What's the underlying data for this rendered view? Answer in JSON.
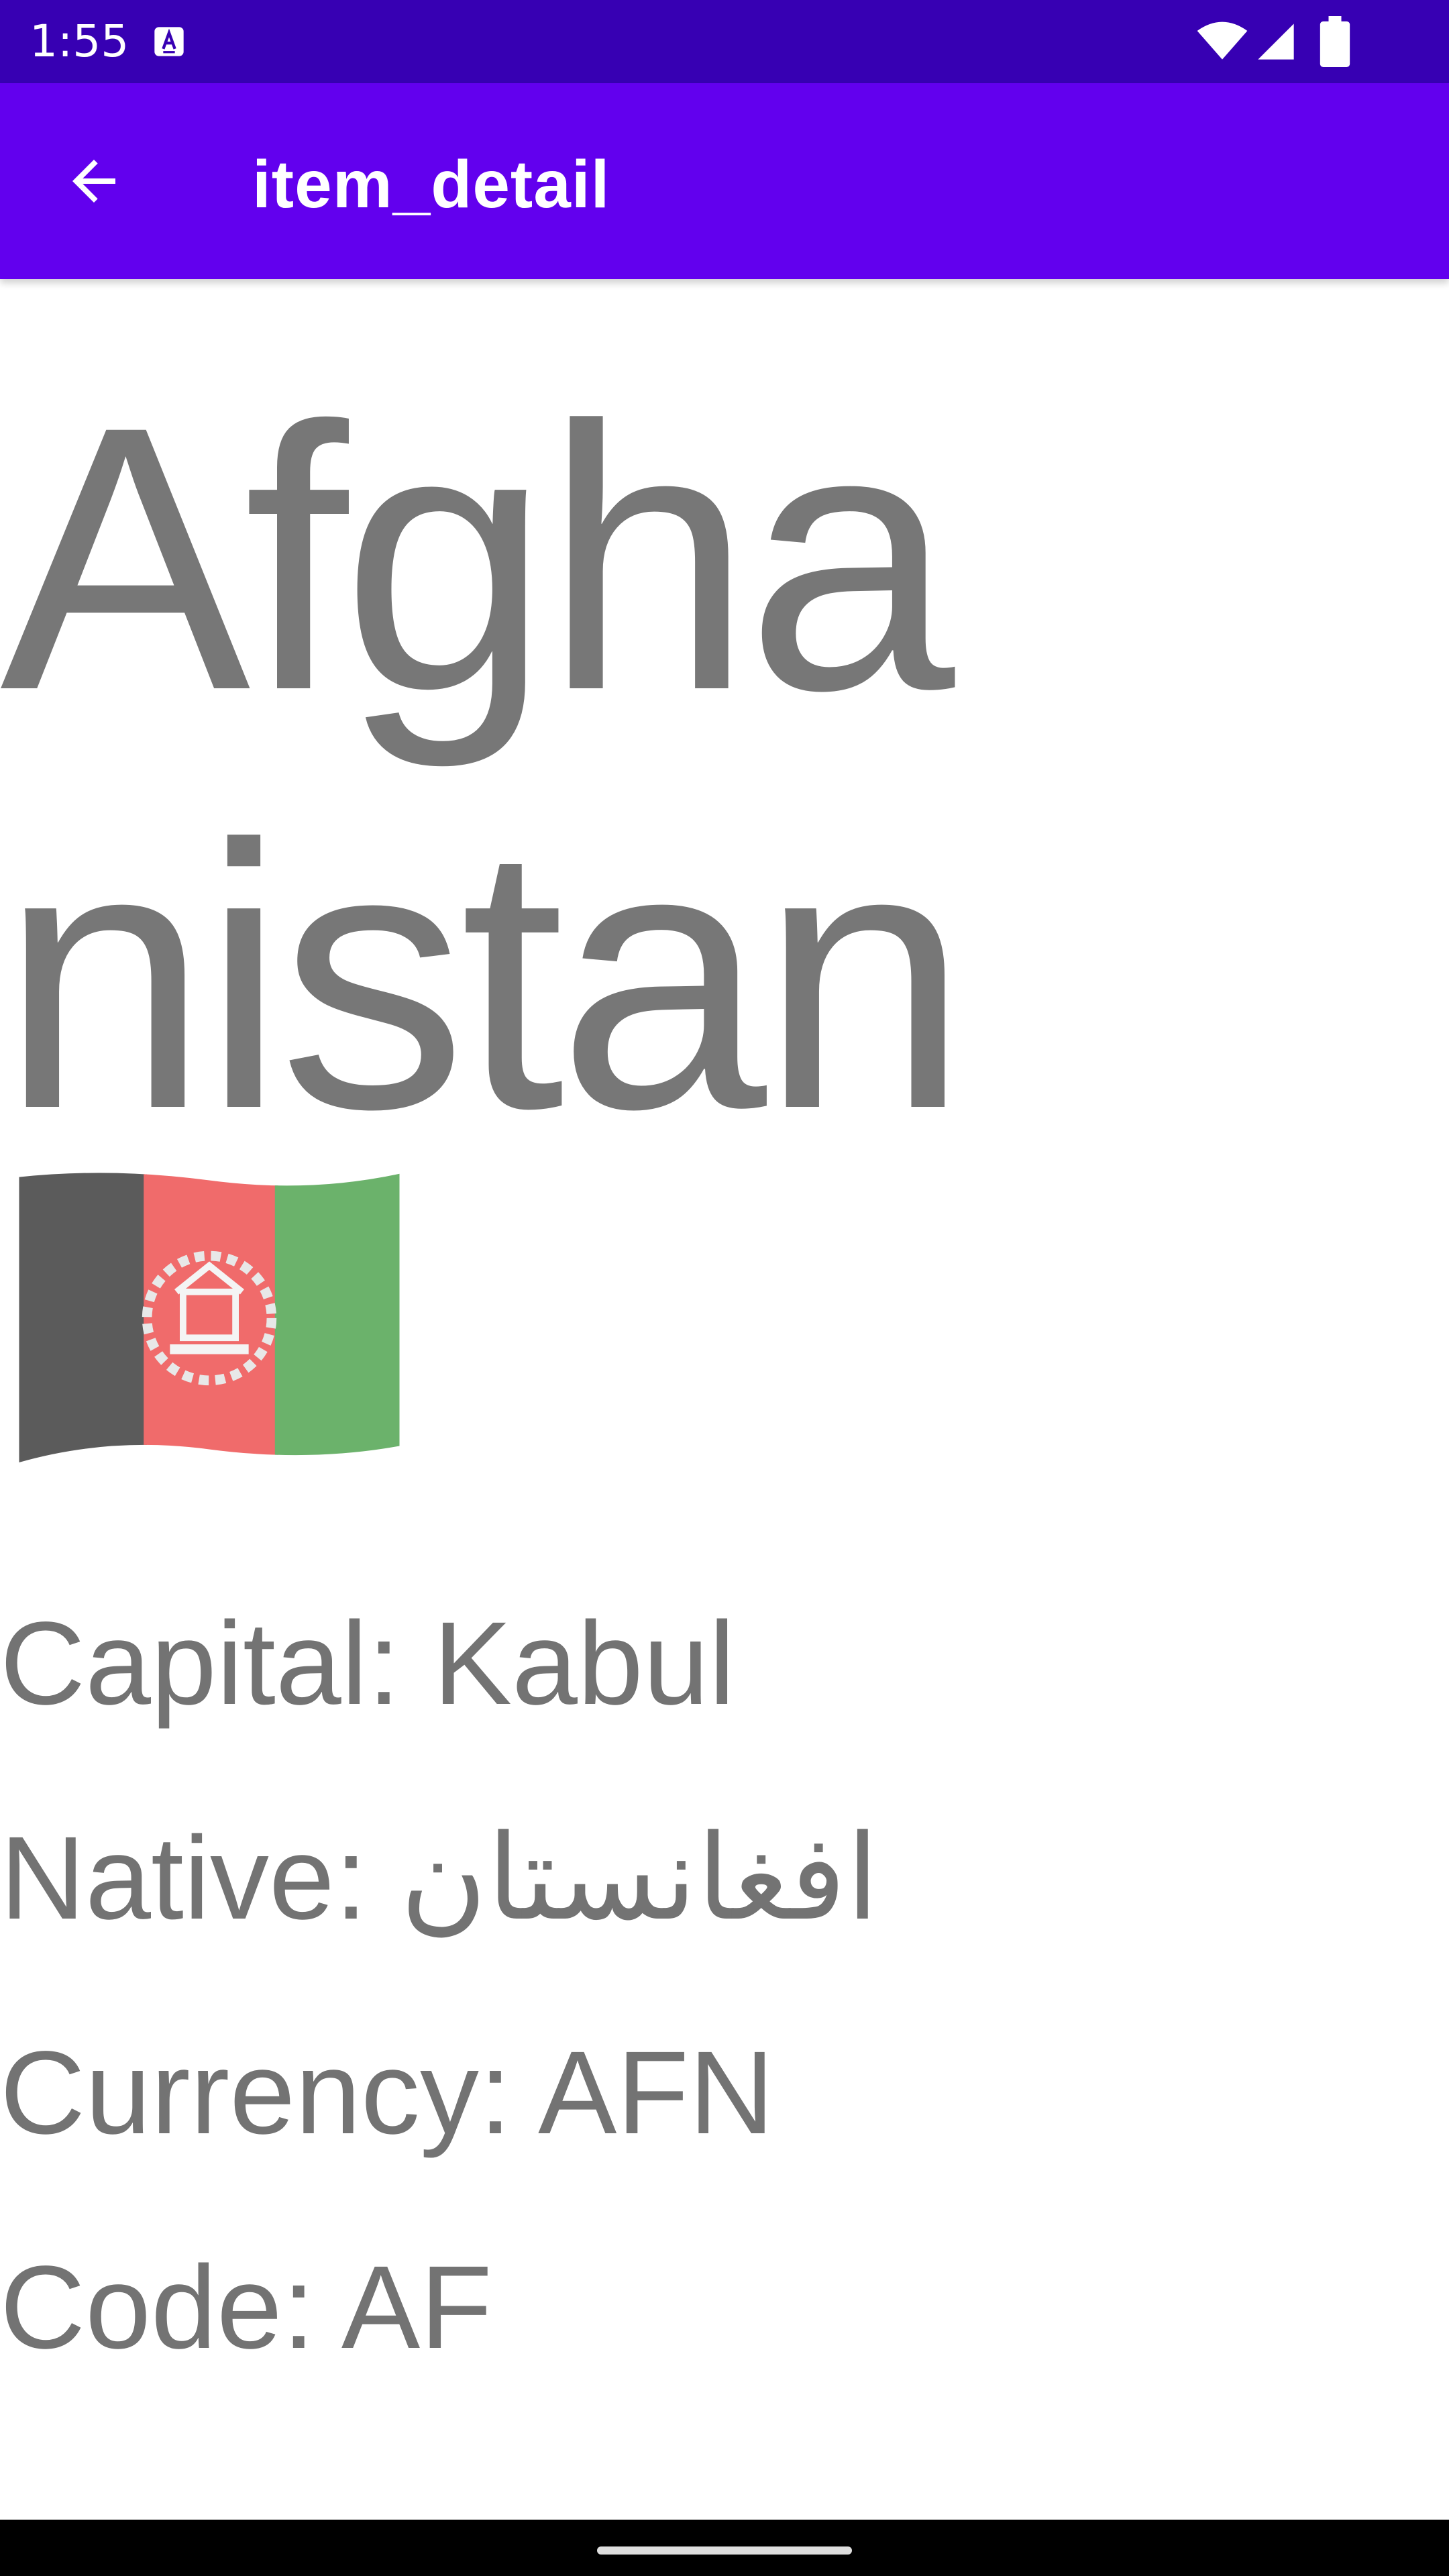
{
  "status_bar": {
    "time": "1:55",
    "icons": [
      "notification-a-icon",
      "wifi-icon",
      "cell-signal-icon",
      "battery-icon"
    ],
    "background": "#3700b3"
  },
  "app_bar": {
    "title": "item_detail",
    "back_icon": "arrow-back-icon",
    "background": "#6200ee"
  },
  "detail": {
    "country_name": "Afghanistan",
    "flag_icon": "afghanistan-flag-icon",
    "capital_line": "Capital: Kabul",
    "native_line": "Native: افغانستان",
    "currency_line": "Currency: AFN",
    "code_line": "Code: AF",
    "text_color": "#777777"
  },
  "nav_bar": {
    "handle": "gesture-handle"
  }
}
